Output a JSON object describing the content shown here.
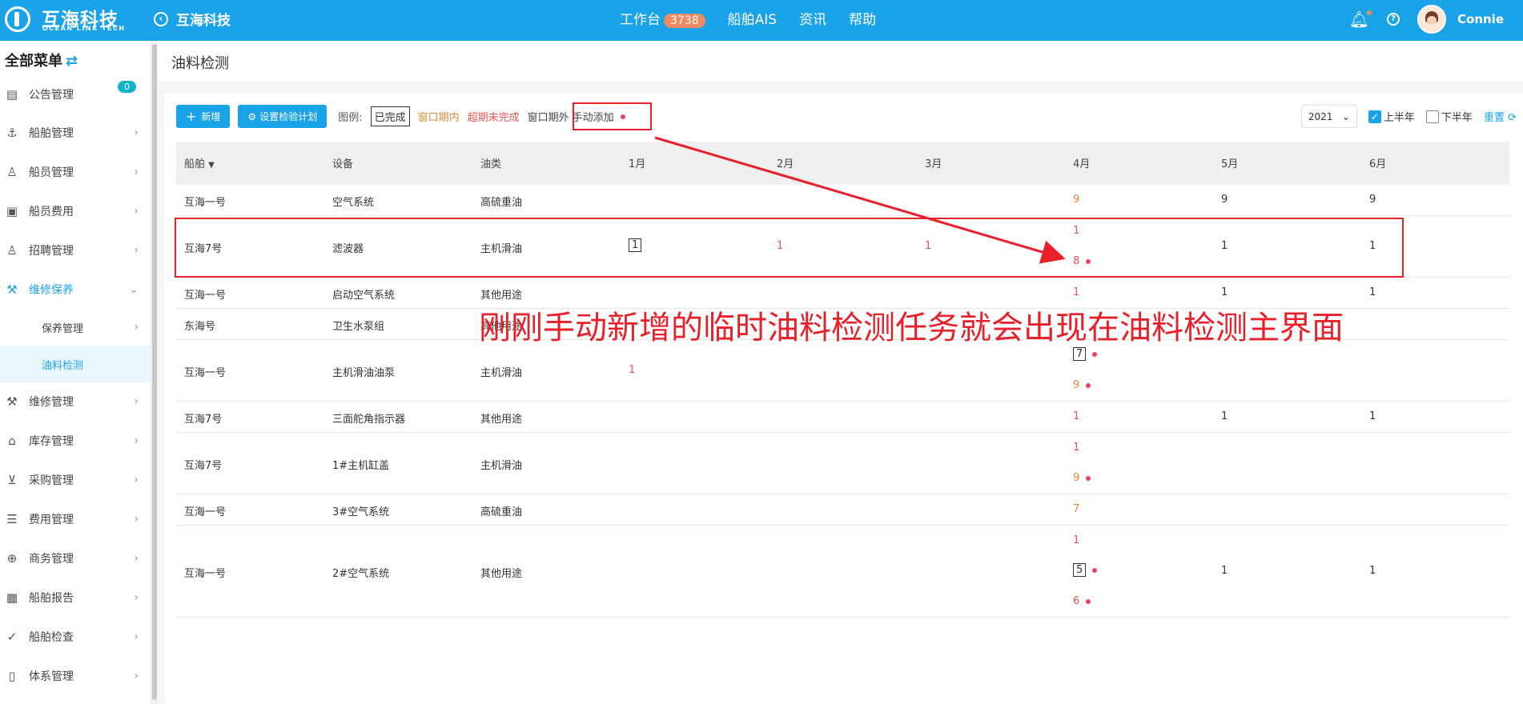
{
  "header": {
    "logo_cn": "互海科技",
    "logo_en": "OCEAN LINK TECH",
    "back_label": "互海科技",
    "nav": [
      {
        "label": "工作台",
        "badge": "3738"
      },
      {
        "label": "船舶AIS"
      },
      {
        "label": "资讯"
      },
      {
        "label": "帮助"
      }
    ],
    "user": "Connie"
  },
  "sidebar": {
    "title": "全部菜单",
    "items": [
      {
        "label": "公告管理",
        "icon": "book-icon",
        "count": "0"
      },
      {
        "label": "船舶管理",
        "icon": "anchor-icon"
      },
      {
        "label": "船员管理",
        "icon": "user-icon"
      },
      {
        "label": "船员费用",
        "icon": "wallet-icon"
      },
      {
        "label": "招聘管理",
        "icon": "recruit-icon"
      },
      {
        "label": "维修保养",
        "icon": "wrench-icon"
      },
      {
        "label": "保养管理"
      },
      {
        "label": "油料检测"
      },
      {
        "label": "维修管理",
        "icon": "tool-icon"
      },
      {
        "label": "库存管理",
        "icon": "home-icon"
      },
      {
        "label": "采购管理",
        "icon": "cart-icon"
      },
      {
        "label": "费用管理",
        "icon": "database-icon"
      },
      {
        "label": "商务管理",
        "icon": "globe-icon"
      },
      {
        "label": "船舶报告",
        "icon": "calendar-icon"
      },
      {
        "label": "船舶检查",
        "icon": "check-circle-icon"
      },
      {
        "label": "体系管理",
        "icon": "document-icon"
      }
    ]
  },
  "page": {
    "title": "油料检测",
    "add_button": "新增",
    "plan_button": "设置检验计划",
    "legend_label": "图例:",
    "legend": {
      "done": "已完成",
      "in_window": "窗口期内",
      "overdue": "超期未完成",
      "out_window": "窗口期外",
      "manual": "手动添加"
    },
    "year": "2021",
    "first_half": "上半年",
    "second_half": "下半年",
    "reset": "重置"
  },
  "table": {
    "headers": [
      "船舶",
      "设备",
      "油类",
      "1月",
      "2月",
      "3月",
      "4月",
      "5月",
      "6月"
    ],
    "rows": [
      {
        "ship": "互海一号",
        "device": "空气系统",
        "oil": "高硫重油"
      },
      {
        "ship": "互海7号",
        "device": "滤波器",
        "oil": "主机滑油"
      },
      {
        "ship": "互海一号",
        "device": "启动空气系统",
        "oil": "其他用途"
      },
      {
        "ship": "东海号",
        "device": "卫生水泵组",
        "oil": "其他用途"
      },
      {
        "ship": "互海一号",
        "device": "主机滑油油泵",
        "oil": "主机滑油"
      },
      {
        "ship": "互海7号",
        "device": "三面舵角指示器",
        "oil": "其他用途"
      },
      {
        "ship": "互海7号",
        "device": "1#主机缸盖",
        "oil": "主机滑油"
      },
      {
        "ship": "互海一号",
        "device": "3#空气系统",
        "oil": "高硫重油"
      },
      {
        "ship": "互海一号",
        "device": "2#空气系统",
        "oil": "其他用途"
      }
    ],
    "marks": {
      "r0_apr": "9",
      "r0_may": "9",
      "r0_jun": "9",
      "r1_jan": "1",
      "r1_feb": "1",
      "r1_mar": "1",
      "r1_apr_a": "1",
      "r1_apr_b": "8",
      "r1_may": "1",
      "r1_jun": "1",
      "r2_apr": "1",
      "r2_may": "1",
      "r2_jun": "1",
      "r4_jan": "1",
      "r4_apr_a": "7",
      "r4_apr_b": "9",
      "r5_apr": "1",
      "r5_may": "1",
      "r5_jun": "1",
      "r6_apr_a": "1",
      "r6_apr_b": "9",
      "r7_apr": "7",
      "r8_apr_a": "1",
      "r8_apr_b": "5",
      "r8_apr_c": "6",
      "r8_may": "1",
      "r8_jun": "1"
    }
  },
  "annotation": "刚刚手动新增的临时油料检测任务就会出现在油料检测主界面"
}
